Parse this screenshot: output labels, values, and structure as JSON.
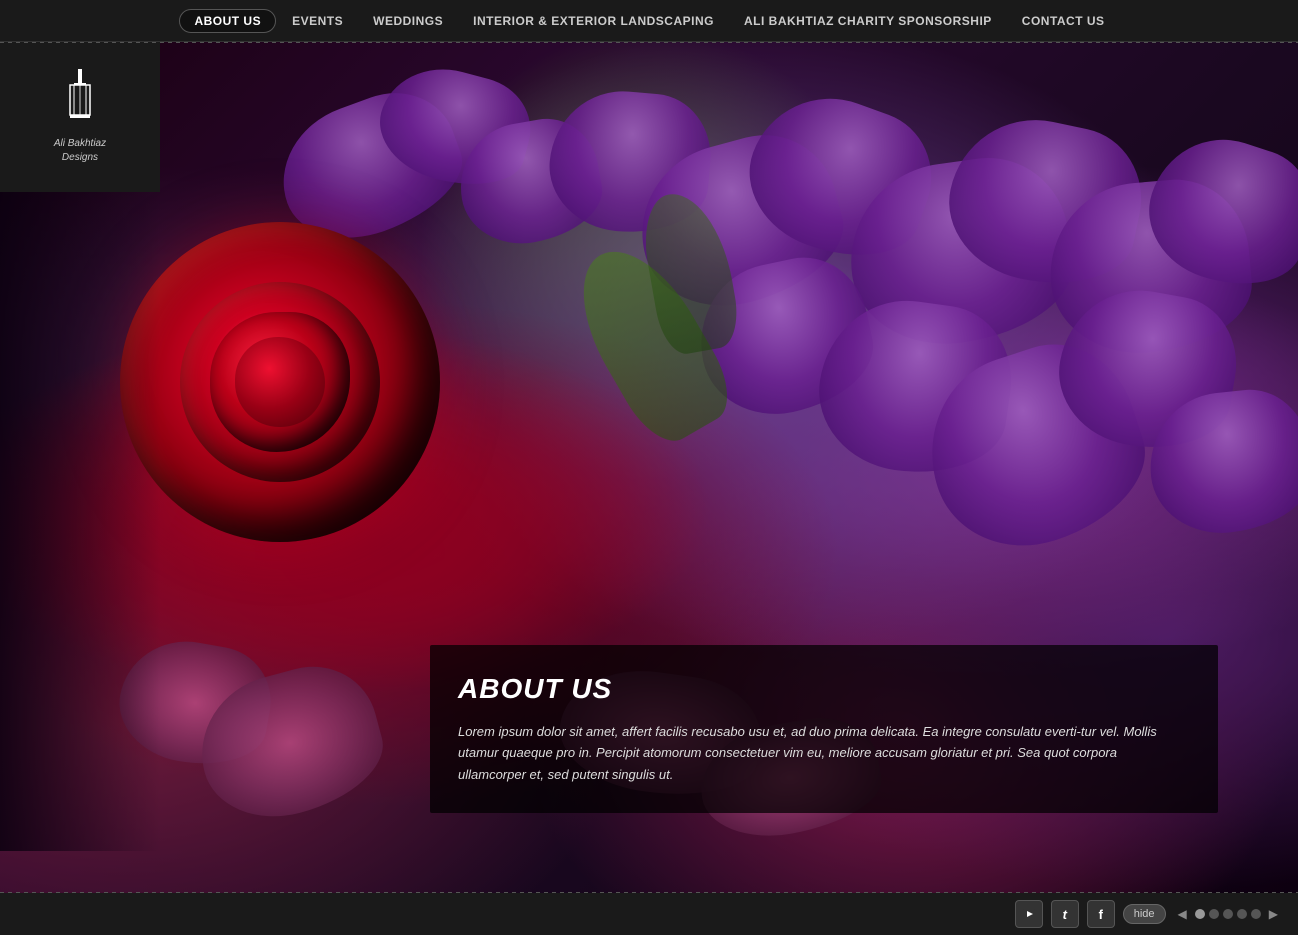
{
  "topbar": {
    "nav_items": [
      {
        "id": "about-us",
        "label": "ABOUT US",
        "active": true
      },
      {
        "id": "events",
        "label": "EVENTS",
        "active": false
      },
      {
        "id": "weddings",
        "label": "WEDDINGS",
        "active": false
      },
      {
        "id": "landscaping",
        "label": "INTERIOR & EXTERIOR LANDSCAPING",
        "active": false
      },
      {
        "id": "charity",
        "label": "ALI BAKHTIAZ CHARITY SPONSORSHIP",
        "active": false
      },
      {
        "id": "contact-us",
        "label": "CONTACT US",
        "active": false
      }
    ]
  },
  "logo": {
    "brand_name": "Ali Bakhtiaz",
    "tagline": "Designs"
  },
  "about": {
    "title": "ABOUT US",
    "body": "Lorem ipsum dolor sit amet, affert facilis recusabo usu et, ad duo prima delicata. Ea integre consulatu everti-tur vel. Mollis utamur quaeque pro in. Percipit atomorum consectetuer vim eu, meliore accusam gloriatur et pri. Sea quot corpora ullamcorper et, sed putent singulis ut."
  },
  "bottombar": {
    "hide_label": "hide",
    "social": [
      {
        "id": "youtube",
        "icon": "▶",
        "label": "YouTube"
      },
      {
        "id": "twitter",
        "icon": "t",
        "label": "Twitter"
      },
      {
        "id": "facebook",
        "icon": "f",
        "label": "Facebook"
      }
    ],
    "dots": [
      {
        "active": true
      },
      {
        "active": false
      },
      {
        "active": false
      },
      {
        "active": false
      },
      {
        "active": false
      }
    ]
  }
}
